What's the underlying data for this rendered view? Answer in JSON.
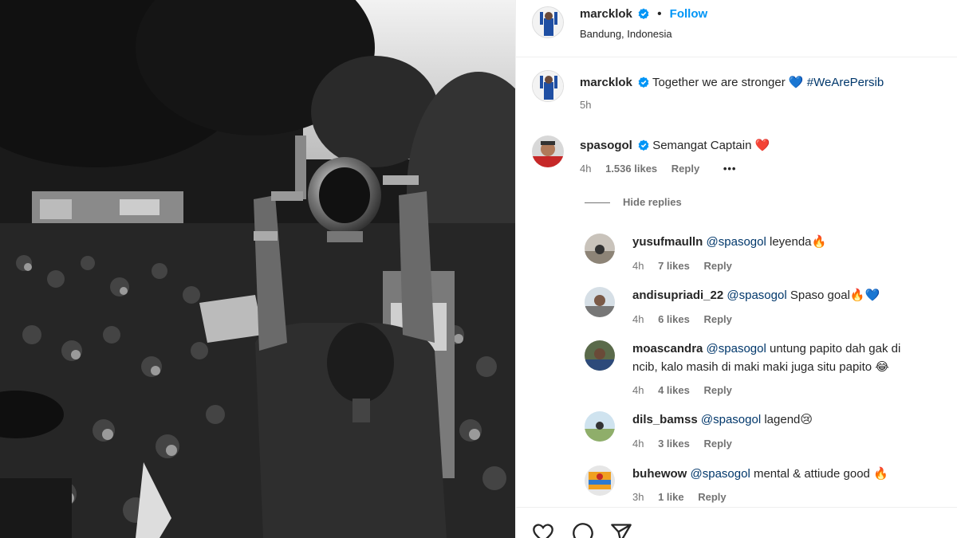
{
  "post": {
    "username": "marcklok",
    "follow_label": "Follow",
    "dot": "•",
    "location": "Bandung, Indonesia",
    "caption": "Together we are stronger",
    "caption_emoji": "💙",
    "hashtag": "#WeArePersib",
    "time": "5h"
  },
  "comment": {
    "username": "spasogol",
    "text": "Semangat Captain",
    "emoji": "❤️",
    "time": "4h",
    "likes": "1.536 likes",
    "reply": "Reply",
    "more": "•••"
  },
  "hide_replies": "Hide replies",
  "replies": [
    {
      "username": "yusufmaulln",
      "mention": "@spasogol",
      "text": "leyenda🔥",
      "time": "4h",
      "likes": "7 likes",
      "reply": "Reply"
    },
    {
      "username": "andisupriadi_22",
      "mention": "@spasogol",
      "text": "Spaso goal🔥💙",
      "time": "4h",
      "likes": "6 likes",
      "reply": "Reply"
    },
    {
      "username": "moascandra",
      "mention": "@spasogol",
      "text": "untung papito dah gak di",
      "text2": "ncib, kalo masih di maki maki juga situ papito 😂",
      "time": "4h",
      "likes": "4 likes",
      "reply": "Reply"
    },
    {
      "username": "dils_bamss",
      "mention": "@spasogol",
      "text": "lagend😢",
      "time": "4h",
      "likes": "3 likes",
      "reply": "Reply"
    },
    {
      "username": "buhewow",
      "mention": "@spasogol",
      "text": "mental & attiude good 🔥",
      "time": "3h",
      "likes": "1 like",
      "reply": "Reply"
    }
  ],
  "icons": [
    "verified-badge-icon",
    "heart-icon",
    "comment-icon",
    "share-icon"
  ],
  "colors": {
    "follow": "#0095f6",
    "verified": "#0095f6",
    "hashtag": "#00376b",
    "meta": "#737373"
  }
}
